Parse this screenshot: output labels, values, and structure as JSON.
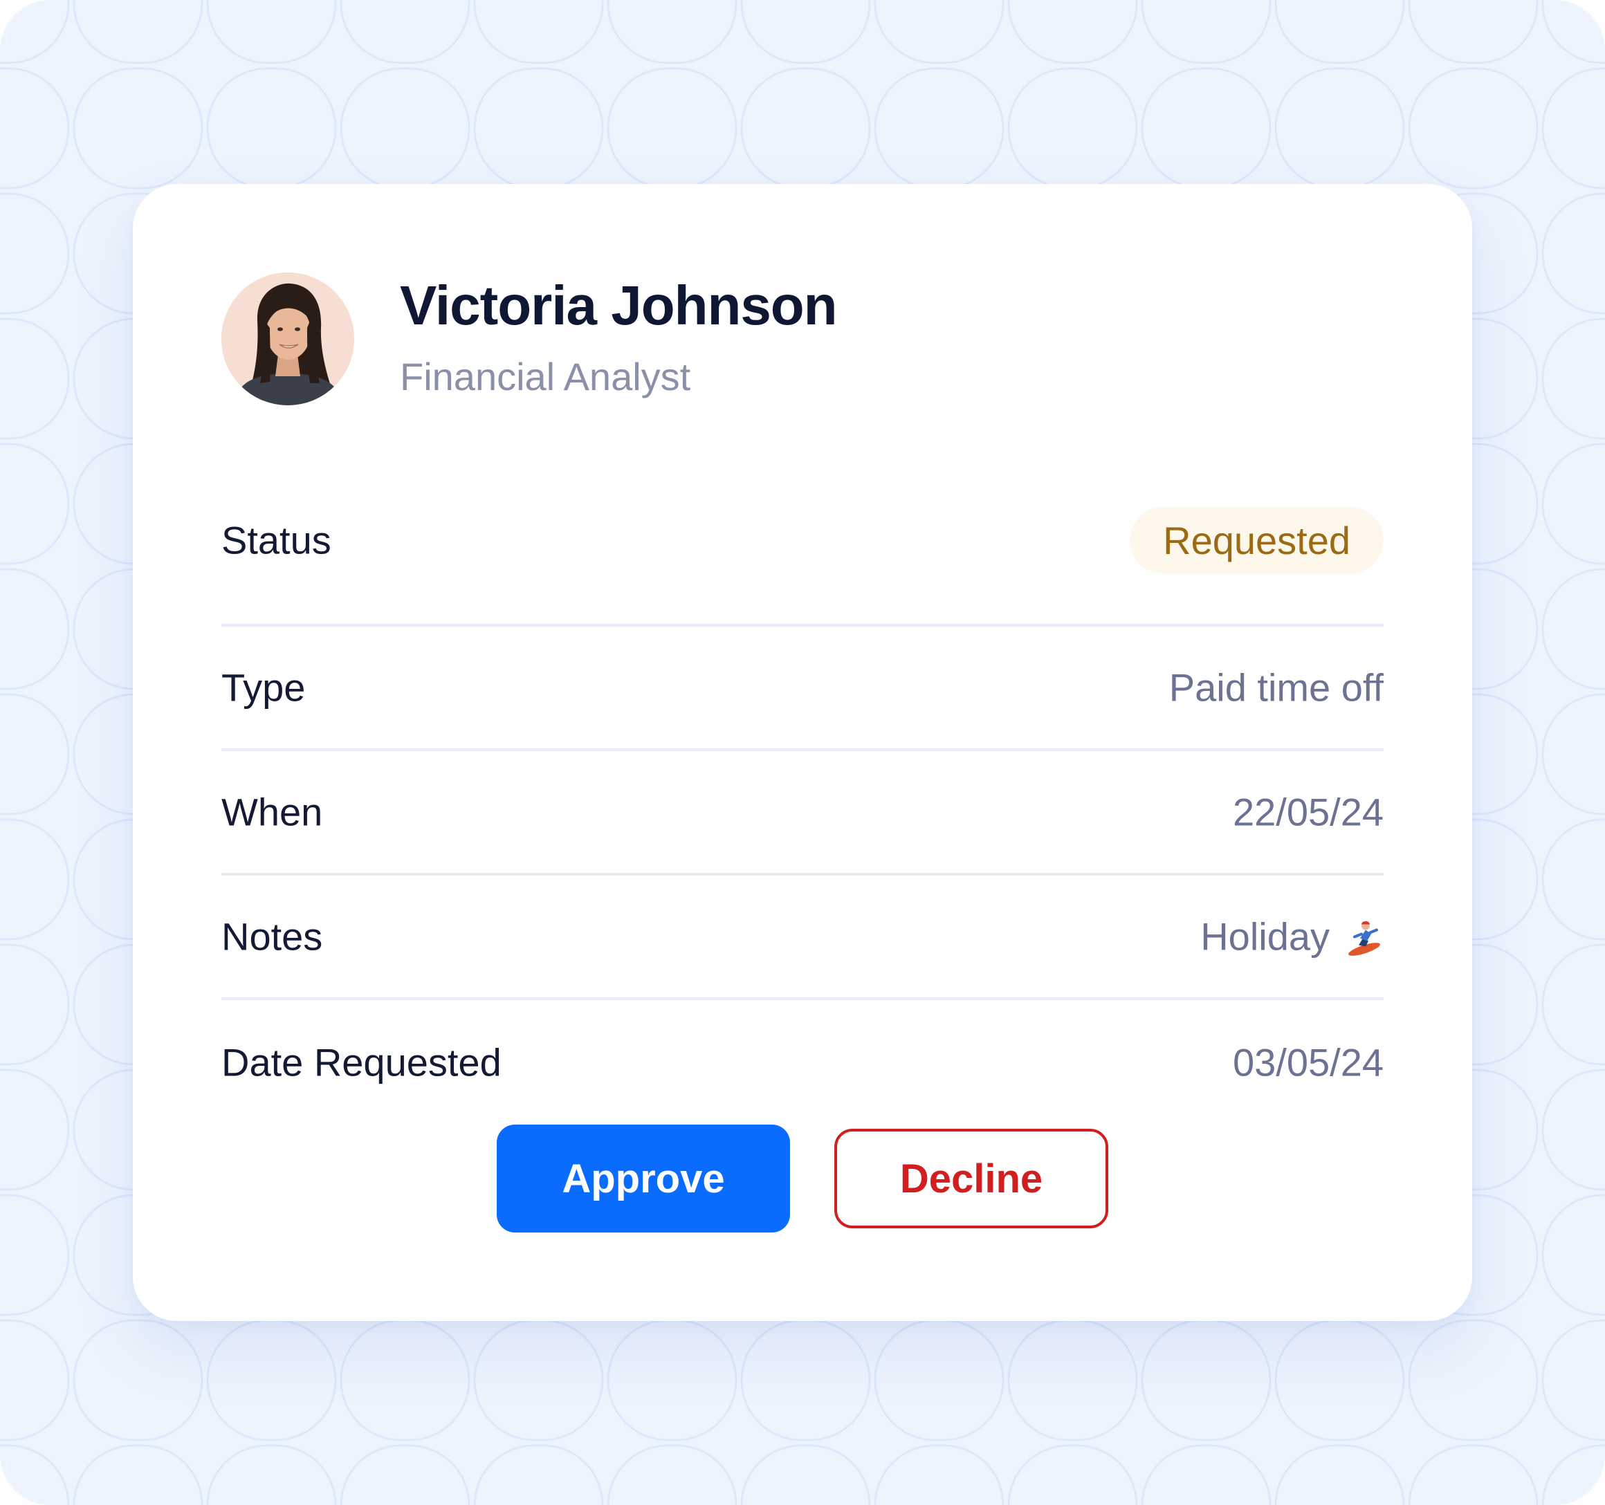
{
  "profile": {
    "name": "Victoria Johnson",
    "role": "Financial Analyst"
  },
  "details": {
    "status_label": "Status",
    "status_value": "Requested",
    "type_label": "Type",
    "type_value": "Paid time off",
    "when_label": "When",
    "when_value": "22/05/24",
    "notes_label": "Notes",
    "notes_value": "Holiday",
    "notes_icon": "snowboarder-icon",
    "date_requested_label": "Date Requested",
    "date_requested_value": "03/05/24"
  },
  "actions": {
    "approve_label": "Approve",
    "decline_label": "Decline"
  },
  "colors": {
    "background": "#eef4fe",
    "card": "#ffffff",
    "primary": "#0a6cff",
    "danger": "#d11f1f",
    "badge_bg": "#fdf7ec",
    "badge_text": "#9a6a14"
  }
}
